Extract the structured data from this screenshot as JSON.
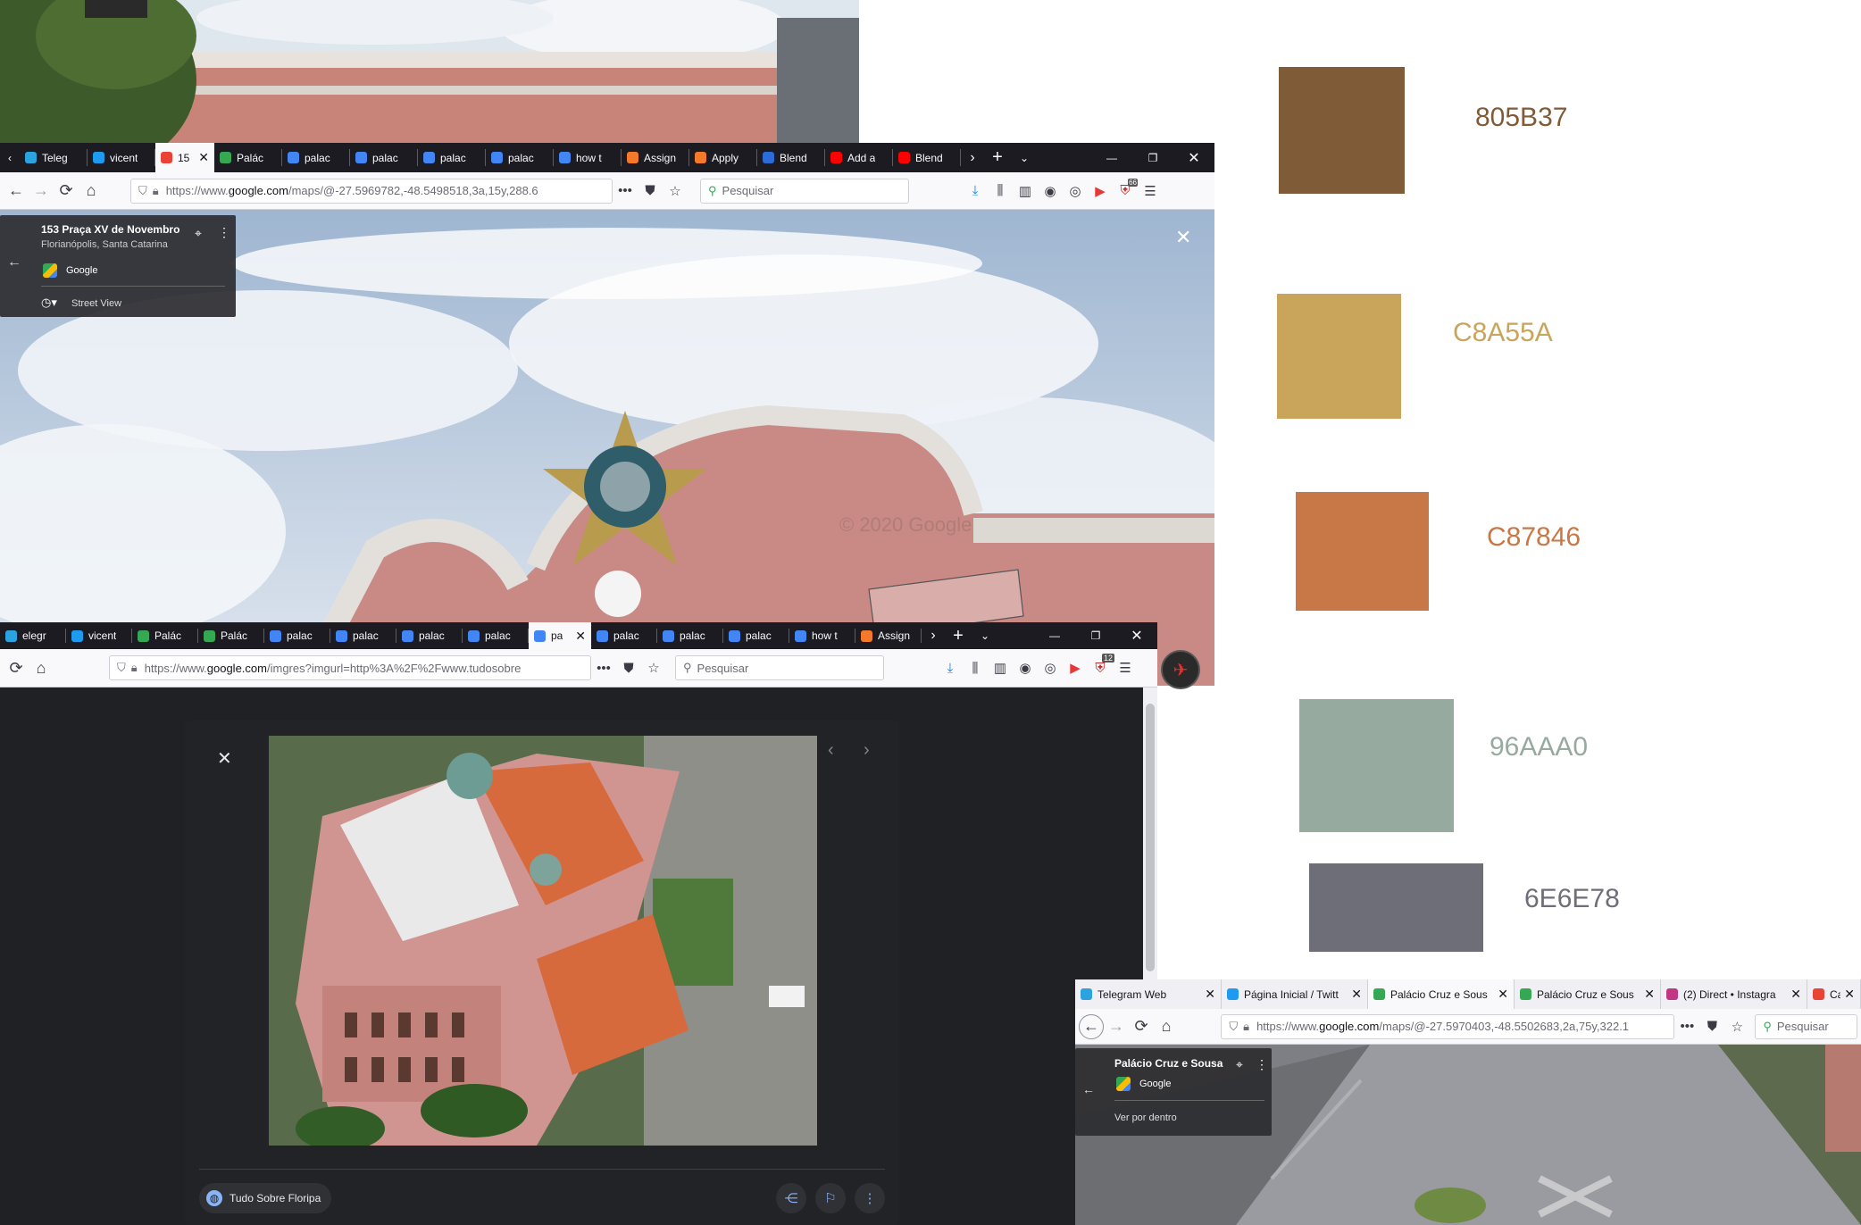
{
  "palette": [
    {
      "hex": "805B37",
      "color": "#805b37"
    },
    {
      "hex": "C8A55A",
      "color": "#c8a55a"
    },
    {
      "hex": "C87846",
      "color": "#c87846"
    },
    {
      "hex": "96AAA0",
      "color": "#96aaa0"
    },
    {
      "hex": "6E6E78",
      "color": "#6e6e78"
    }
  ],
  "window1": {
    "tabs": [
      {
        "label": "Teleg",
        "icon": "telegram-icon",
        "color": "#2aa3e0"
      },
      {
        "label": "vicent",
        "icon": "twitter-icon",
        "color": "#1d9bf0"
      },
      {
        "label": "15",
        "icon": "maps-pin-icon",
        "color": "#ea4335",
        "active": true
      },
      {
        "label": "Palác",
        "icon": "maps-pin-icon",
        "color": "#34a853"
      },
      {
        "label": "palac",
        "icon": "google-icon",
        "color": "#4285f4"
      },
      {
        "label": "palac",
        "icon": "google-icon",
        "color": "#4285f4"
      },
      {
        "label": "palac",
        "icon": "google-icon",
        "color": "#4285f4"
      },
      {
        "label": "palac",
        "icon": "google-icon",
        "color": "#4285f4"
      },
      {
        "label": "how t",
        "icon": "google-icon",
        "color": "#4285f4"
      },
      {
        "label": "Assign",
        "icon": "blender-icon",
        "color": "#f5792a"
      },
      {
        "label": "Apply",
        "icon": "blender-icon",
        "color": "#f5792a"
      },
      {
        "label": "Blend",
        "icon": "3d-icon",
        "color": "#2b6cd9"
      },
      {
        "label": "Add a",
        "icon": "youtube-icon",
        "color": "#ff0000"
      },
      {
        "label": "Blend",
        "icon": "youtube-icon",
        "color": "#ff0000"
      }
    ],
    "url_prefix": "https://www.",
    "url_domain": "google.com",
    "url_rest": "/maps/@-27.5969782,-48.5498518,3a,15y,288.6",
    "search_placeholder": "Pesquisar",
    "address_title": "153 Praça XV de Novembro",
    "address_subtitle": "Florianópolis, Santa Catarina",
    "provider": "Google",
    "street_view_label": "Street View",
    "watermark": "© 2020 Google",
    "close_glyph": "✕"
  },
  "window2": {
    "tabs": [
      {
        "label": "elegr",
        "icon": "telegram-icon",
        "color": "#2aa3e0"
      },
      {
        "label": "vicent",
        "icon": "twitter-icon",
        "color": "#1d9bf0"
      },
      {
        "label": "Palác",
        "icon": "maps-pin-icon",
        "color": "#34a853"
      },
      {
        "label": "Palác",
        "icon": "maps-pin-icon",
        "color": "#34a853"
      },
      {
        "label": "palac",
        "icon": "google-icon",
        "color": "#4285f4"
      },
      {
        "label": "palac",
        "icon": "google-icon",
        "color": "#4285f4"
      },
      {
        "label": "palac",
        "icon": "google-icon",
        "color": "#4285f4"
      },
      {
        "label": "palac",
        "icon": "google-icon",
        "color": "#4285f4"
      },
      {
        "label": "pa",
        "icon": "google-icon",
        "color": "#4285f4",
        "active": true
      },
      {
        "label": "palac",
        "icon": "google-icon",
        "color": "#4285f4"
      },
      {
        "label": "palac",
        "icon": "google-icon",
        "color": "#4285f4"
      },
      {
        "label": "palac",
        "icon": "google-icon",
        "color": "#4285f4"
      },
      {
        "label": "how t",
        "icon": "google-icon",
        "color": "#4285f4"
      },
      {
        "label": "Assign",
        "icon": "blender-icon",
        "color": "#f5792a"
      }
    ],
    "url_prefix": "https://www.",
    "url_domain": "google.com",
    "url_rest": "/imgres?imgurl=http%3A%2F%2Fwww.tudosobre",
    "search_placeholder": "Pesquisar",
    "badge_count": "12",
    "source_label": "Tudo Sobre Floripa"
  },
  "window3": {
    "tabs": [
      {
        "label": "Telegram Web",
        "icon": "telegram-icon",
        "color": "#2aa3e0"
      },
      {
        "label": "Página Inicial / Twitt",
        "icon": "twitter-icon",
        "color": "#1d9bf0"
      },
      {
        "label": "Palácio Cruz e Sous",
        "icon": "maps-pin-icon",
        "color": "#34a853",
        "active": true
      },
      {
        "label": "Palácio Cruz e Sous",
        "icon": "maps-pin-icon",
        "color": "#34a853"
      },
      {
        "label": "(2) Direct • Instagra",
        "icon": "instagram-icon",
        "color": "#c13584"
      },
      {
        "label": "Caixa",
        "icon": "gmail-icon",
        "color": "#ea4335"
      }
    ],
    "url_prefix": "https://www.",
    "url_domain": "google.com",
    "url_rest": "/maps/@-27.5970403,-48.5502683,2a,75y,322.1",
    "search_placeholder": "Pesquisar",
    "place_title": "Palácio Cruz e Sousa",
    "provider": "Google",
    "inside_label": "Ver por dentro"
  },
  "window1_badge": "66"
}
